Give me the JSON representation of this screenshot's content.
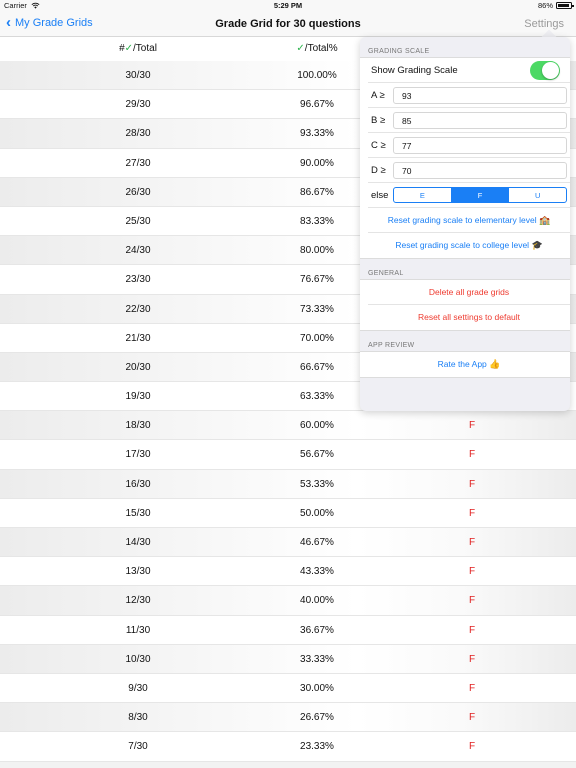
{
  "status_bar": {
    "carrier": "Carrier",
    "time": "5:29 PM",
    "battery": "86%"
  },
  "nav": {
    "back_label": "My Grade Grids",
    "title": "Grade Grid for 30 questions",
    "settings_label": "Settings"
  },
  "table": {
    "headers": {
      "count": "#✓/Total",
      "count_prefix": "#",
      "count_suffix": "/Total",
      "percent_suffix": "/Total%"
    },
    "rows": [
      {
        "score": "30/30",
        "percent": "100.00%",
        "grade": ""
      },
      {
        "score": "29/30",
        "percent": "96.67%",
        "grade": ""
      },
      {
        "score": "28/30",
        "percent": "93.33%",
        "grade": ""
      },
      {
        "score": "27/30",
        "percent": "90.00%",
        "grade": ""
      },
      {
        "score": "26/30",
        "percent": "86.67%",
        "grade": ""
      },
      {
        "score": "25/30",
        "percent": "83.33%",
        "grade": ""
      },
      {
        "score": "24/30",
        "percent": "80.00%",
        "grade": ""
      },
      {
        "score": "23/30",
        "percent": "76.67%",
        "grade": ""
      },
      {
        "score": "22/30",
        "percent": "73.33%",
        "grade": ""
      },
      {
        "score": "21/30",
        "percent": "70.00%",
        "grade": ""
      },
      {
        "score": "20/30",
        "percent": "66.67%",
        "grade": ""
      },
      {
        "score": "19/30",
        "percent": "63.33%",
        "grade": ""
      },
      {
        "score": "18/30",
        "percent": "60.00%",
        "grade": "F"
      },
      {
        "score": "17/30",
        "percent": "56.67%",
        "grade": "F"
      },
      {
        "score": "16/30",
        "percent": "53.33%",
        "grade": "F"
      },
      {
        "score": "15/30",
        "percent": "50.00%",
        "grade": "F"
      },
      {
        "score": "14/30",
        "percent": "46.67%",
        "grade": "F"
      },
      {
        "score": "13/30",
        "percent": "43.33%",
        "grade": "F"
      },
      {
        "score": "12/30",
        "percent": "40.00%",
        "grade": "F"
      },
      {
        "score": "11/30",
        "percent": "36.67%",
        "grade": "F"
      },
      {
        "score": "10/30",
        "percent": "33.33%",
        "grade": "F"
      },
      {
        "score": "9/30",
        "percent": "30.00%",
        "grade": "F"
      },
      {
        "score": "8/30",
        "percent": "26.67%",
        "grade": "F"
      },
      {
        "score": "7/30",
        "percent": "23.33%",
        "grade": "F"
      }
    ]
  },
  "settings": {
    "grading_scale_header": "GRADING SCALE",
    "show_grading_scale_label": "Show Grading Scale",
    "show_grading_scale_on": true,
    "thresholds": [
      {
        "label": "A ≥",
        "value": "93"
      },
      {
        "label": "B ≥",
        "value": "85"
      },
      {
        "label": "C ≥",
        "value": "77"
      },
      {
        "label": "D ≥",
        "value": "70"
      }
    ],
    "else_label": "else",
    "else_options": [
      "E",
      "F",
      "U"
    ],
    "else_selected": "F",
    "reset_elementary": "Reset grading scale to elementary level",
    "reset_college": "Reset grading scale to college level",
    "general_header": "GENERAL",
    "delete_all": "Delete all grade grids",
    "reset_all": "Reset all settings to default",
    "app_review_header": "APP REVIEW",
    "rate_app": "Rate the App"
  },
  "colors": {
    "accent": "#1a7ff5",
    "destructive": "#ee3b30",
    "grade": "#e02020",
    "toggle_on": "#4cd964",
    "check": "#2bb24c"
  },
  "icons": [
    "wifi-icon",
    "battery-icon",
    "chevron-left-icon",
    "checkmark-icon",
    "school-icon",
    "graduation-cap-icon",
    "thumbs-up-icon"
  ]
}
